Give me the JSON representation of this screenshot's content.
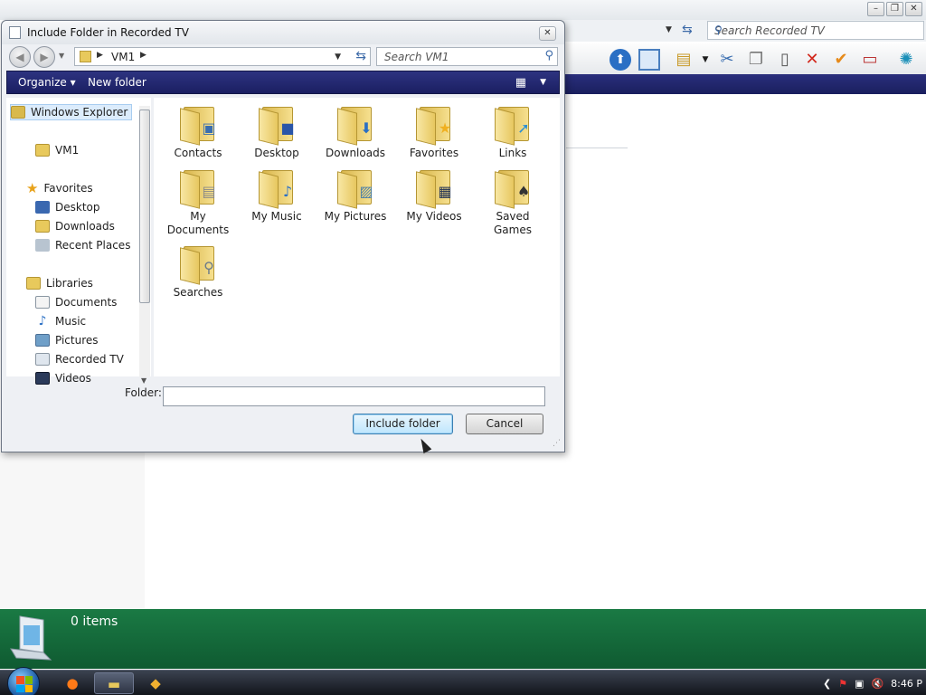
{
  "background_window": {
    "search_placeholder": "Search Recorded TV",
    "status_count": "0 items",
    "controls": [
      "–",
      "❐",
      "✕"
    ]
  },
  "dialog": {
    "title": "Include Folder in Recorded TV",
    "close": "✕",
    "address": {
      "crumb": "VM1"
    },
    "search_placeholder": "Search VM1",
    "toolbar": {
      "organize": "Organize",
      "organize_arrow": "▾",
      "new_folder": "New folder"
    },
    "nav_pane": {
      "windows_explorer": "Windows Explorer",
      "vm1": "VM1",
      "favorites_header": "Favorites",
      "favorites": [
        "Desktop",
        "Downloads",
        "Recent Places"
      ],
      "libraries_header": "Libraries",
      "libraries": [
        "Documents",
        "Music",
        "Pictures",
        "Recorded TV",
        "Videos"
      ]
    },
    "folders": [
      {
        "label": "Contacts",
        "icon": "contacts-badge"
      },
      {
        "label": "Desktop",
        "icon": "desktop-badge"
      },
      {
        "label": "Downloads",
        "icon": "download-arrow-badge"
      },
      {
        "label": "Favorites",
        "icon": "star-badge"
      },
      {
        "label": "Links",
        "icon": "link-arrow-badge"
      },
      {
        "label": "My Documents",
        "icon": "document-badge"
      },
      {
        "label": "My Music",
        "icon": "music-note-badge"
      },
      {
        "label": "My Pictures",
        "icon": "picture-badge"
      },
      {
        "label": "My Videos",
        "icon": "film-badge"
      },
      {
        "label": "Saved Games",
        "icon": "chess-piece-badge"
      },
      {
        "label": "Searches",
        "icon": "magnifier-badge"
      }
    ],
    "folder_label": "Folder:",
    "folder_value": "",
    "include_button": "Include folder",
    "cancel_button": "Cancel"
  },
  "taskbar": {
    "clock": "8:46 P"
  },
  "colors": {
    "dialog_toolbar": "#1b1f62",
    "status_band": "#127043",
    "taskbar": "#1a1e26",
    "folder_yellow": "#e7c75f"
  }
}
